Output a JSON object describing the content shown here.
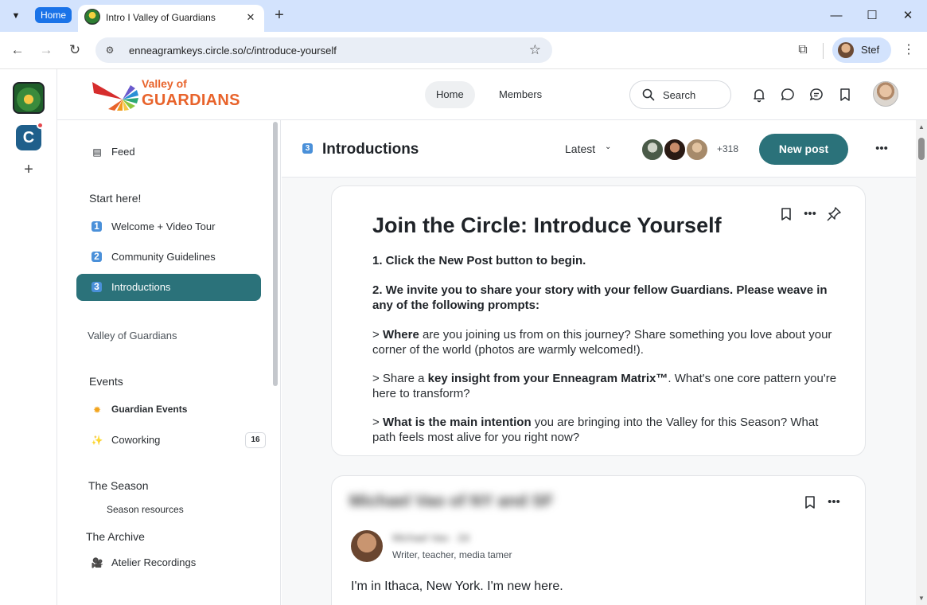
{
  "browser": {
    "tab_group_label": "Home",
    "tab_title": "Intro I Valley of Guardians",
    "url": "enneagramkeys.circle.so/c/introduce-yourself",
    "profile_name": "Stef"
  },
  "site": {
    "logo_line1": "Valley of",
    "logo_line2": "GUARDIANS",
    "nav": [
      {
        "label": "Home",
        "active": true
      },
      {
        "label": "Members",
        "active": false
      }
    ],
    "search_label": "Search"
  },
  "sidebar": {
    "feed": "Feed",
    "start_heading": "Start here!",
    "start_items": [
      {
        "num": "1",
        "label": "Welcome + Video Tour"
      },
      {
        "num": "2",
        "label": "Community Guidelines"
      },
      {
        "num": "3",
        "label": "Introductions",
        "active": true
      }
    ],
    "community_heading": "Valley of Guardians",
    "events_heading": "Events",
    "event_items": [
      {
        "label": "Guardian Events",
        "icon": "sun-icon"
      },
      {
        "label": "Coworking",
        "icon": "sparkles-icon",
        "count": "16"
      }
    ],
    "season_heading": "The Season",
    "season_resources": "Season resources",
    "archive_heading": "The Archive",
    "archive_items": [
      {
        "label": "Atelier Recordings",
        "icon": "camera-icon"
      }
    ]
  },
  "space": {
    "badge": "3",
    "title": "Introductions",
    "sort_label": "Latest",
    "member_extra": "+318",
    "new_post_label": "New post"
  },
  "pinned_post": {
    "title": "Join the Circle: Introduce Yourself",
    "step1": "1. Click the New Post button to begin.",
    "step2": "2. We invite you to share your story with your fellow Guardians. Please weave in any of the following prompts:",
    "prompt1_prefix": "> ",
    "prompt1_bold": "Where",
    "prompt1_rest": " are you joining us from on this journey? Share something you love about your corner of the world (photos are warmly welcomed!).",
    "prompt2_prefix": "> Share a ",
    "prompt2_bold": "key insight from your Enneagram Matrix™",
    "prompt2_rest": ". What's one core pattern you're here to transform?",
    "prompt3_prefix": "> ",
    "prompt3_bold": "What is the main intention",
    "prompt3_rest": " you are bringing into the Valley for this Season? What path feels most alive for you right now?"
  },
  "second_post": {
    "title": "Michael Vao of NY and SF",
    "author_name": "Michael Vao · 2d",
    "author_bio": "Writer, teacher, media tamer",
    "body": "I'm in Ithaca, New York. I'm new here."
  },
  "colors": {
    "accent": "#2b727a",
    "brand_orange": "#e8632b",
    "number_badge": "#4a90d9"
  }
}
